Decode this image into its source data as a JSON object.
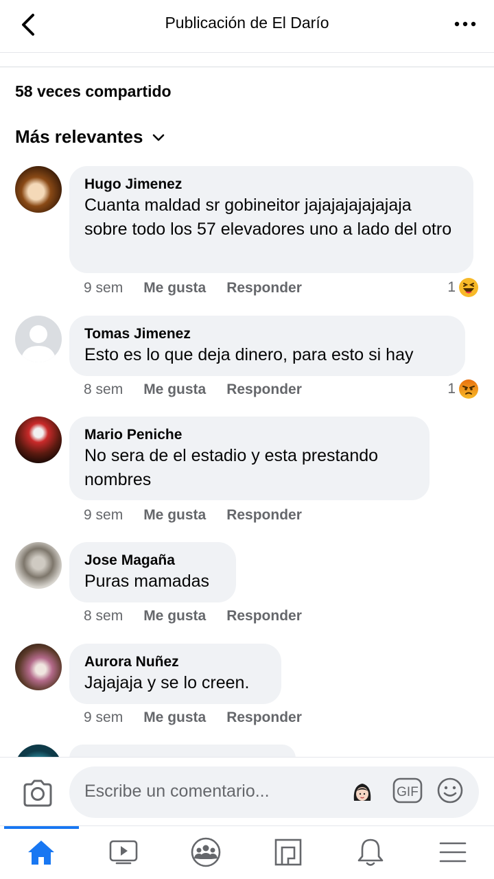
{
  "header": {
    "title": "Publicación de El Darío"
  },
  "post": {
    "shares": "58 veces compartido"
  },
  "sort": {
    "label": "Más relevantes"
  },
  "comments": [
    {
      "author": "Hugo Jimenez",
      "text": "Cuanta maldad sr gobineitor jajajajajajajaja sobre todo los 57 elevadores uno a lado del otro",
      "time": "9 sem",
      "like": "Me gusta",
      "reply": "Responder",
      "reaction_count": "1",
      "reaction": "haha"
    },
    {
      "author": "Tomas Jimenez",
      "text": "Esto es lo que deja dinero, para esto si hay",
      "time": "8 sem",
      "like": "Me gusta",
      "reply": "Responder",
      "reaction_count": "1",
      "reaction": "angry"
    },
    {
      "author": "Mario Peniche",
      "text": "No sera de el estadio y esta prestando nombres",
      "time": "9 sem",
      "like": "Me gusta",
      "reply": "Responder"
    },
    {
      "author": "Jose Magaña",
      "text": "Puras mamadas",
      "time": "8 sem",
      "like": "Me gusta",
      "reply": "Responder"
    },
    {
      "author": "Aurora Nuñez",
      "text": "Jajajaja y se lo creen.",
      "time": "9 sem",
      "like": "Me gusta",
      "reply": "Responder"
    }
  ],
  "composer": {
    "placeholder": "Escribe un comentario...",
    "gif_label": "GIF"
  },
  "nav": {
    "items": [
      "home-icon",
      "watch-icon",
      "groups-icon",
      "pages-icon",
      "notifications-icon",
      "menu-icon"
    ],
    "active": 0
  },
  "colors": {
    "accent": "#1877f2",
    "bubble": "#f0f2f5",
    "muted": "#65676b"
  }
}
